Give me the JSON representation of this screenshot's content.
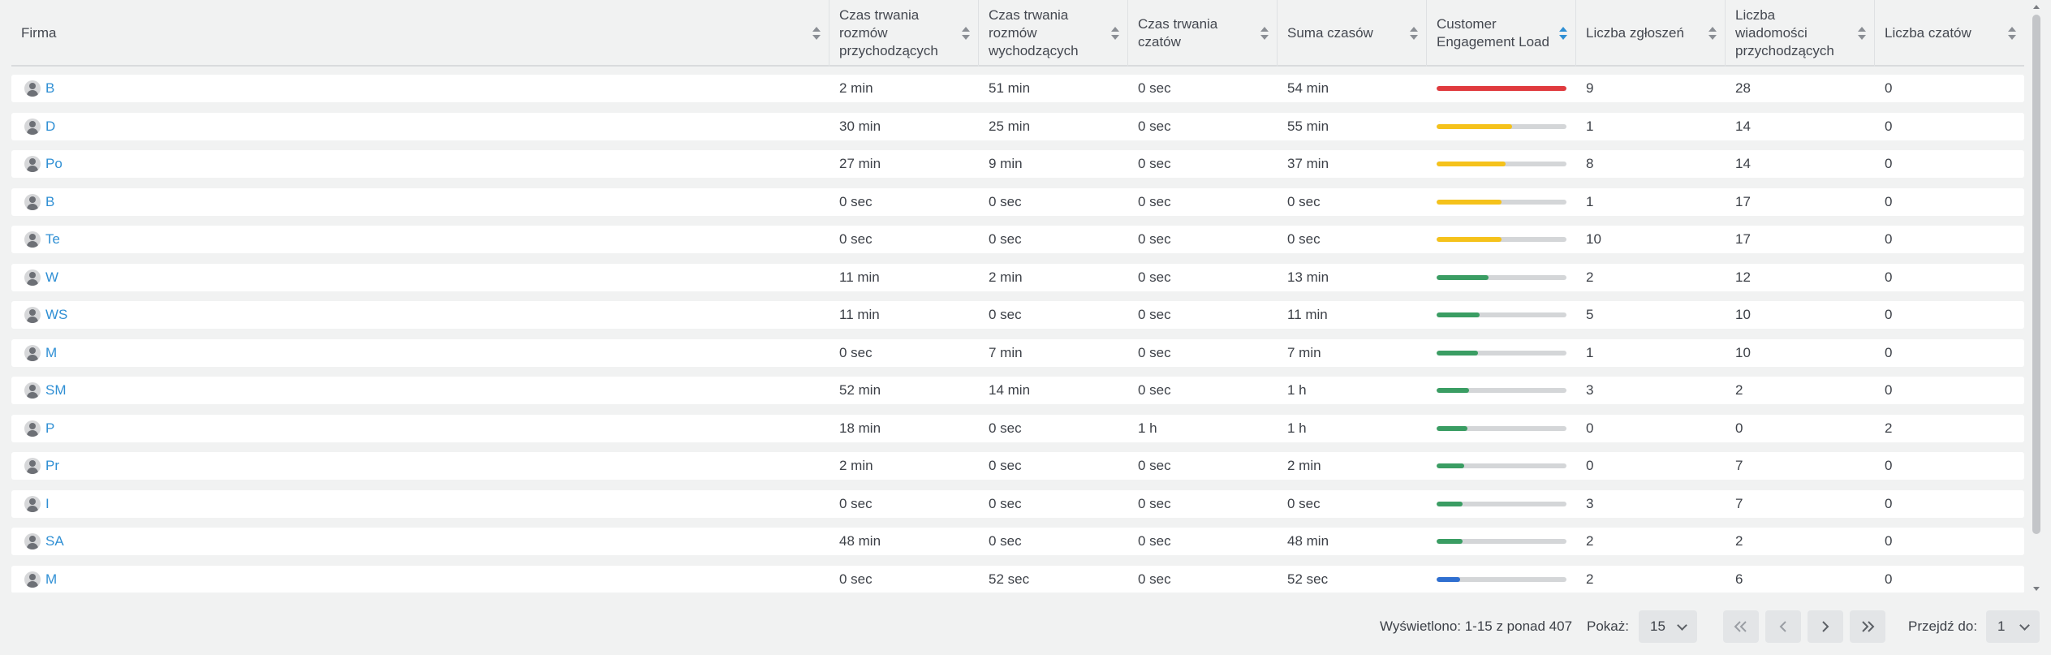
{
  "columns": [
    {
      "label": "Firma"
    },
    {
      "label": "Czas trwania rozmów przychodzących"
    },
    {
      "label": "Czas trwania rozmów wychodzących"
    },
    {
      "label": "Czas trwania czatów"
    },
    {
      "label": "Suma czasów"
    },
    {
      "label": "Customer Engagement Load"
    },
    {
      "label": "Liczba zgłoszeń"
    },
    {
      "label": "Liczba wiadomości przychodzących"
    },
    {
      "label": "Liczba czatów"
    }
  ],
  "colors": {
    "link": "#2f8fd4",
    "load_red": "#e03a3e",
    "load_yellow": "#f5c21b",
    "load_green": "#3a9d63",
    "load_blue": "#2f6fd0"
  },
  "rows": [
    {
      "firma": "B",
      "in": "2 min",
      "out": "51 min",
      "chat": "0 sec",
      "sum": "54 min",
      "load": 1.0,
      "load_color": "red",
      "tickets": "9",
      "msgs": "28",
      "chats": "0"
    },
    {
      "firma": "D",
      "in": "30 min",
      "out": "25 min",
      "chat": "0 sec",
      "sum": "55 min",
      "load": 0.58,
      "load_color": "yellow",
      "tickets": "1",
      "msgs": "14",
      "chats": "0"
    },
    {
      "firma": "Po",
      "in": "27 min",
      "out": "9 min",
      "chat": "0 sec",
      "sum": "37 min",
      "load": 0.53,
      "load_color": "yellow",
      "tickets": "8",
      "msgs": "14",
      "chats": "0"
    },
    {
      "firma": "B",
      "in": "0 sec",
      "out": "0 sec",
      "chat": "0 sec",
      "sum": "0 sec",
      "load": 0.5,
      "load_color": "yellow",
      "tickets": "1",
      "msgs": "17",
      "chats": "0"
    },
    {
      "firma": "Te",
      "in": "0 sec",
      "out": "0 sec",
      "chat": "0 sec",
      "sum": "0 sec",
      "load": 0.5,
      "load_color": "yellow",
      "tickets": "10",
      "msgs": "17",
      "chats": "0"
    },
    {
      "firma": "W",
      "in": "11 min",
      "out": "2 min",
      "chat": "0 sec",
      "sum": "13 min",
      "load": 0.4,
      "load_color": "green",
      "tickets": "2",
      "msgs": "12",
      "chats": "0"
    },
    {
      "firma": "WS",
      "in": "11 min",
      "out": "0 sec",
      "chat": "0 sec",
      "sum": "11 min",
      "load": 0.33,
      "load_color": "green",
      "tickets": "5",
      "msgs": "10",
      "chats": "0"
    },
    {
      "firma": "M",
      "in": "0 sec",
      "out": "7 min",
      "chat": "0 sec",
      "sum": "7 min",
      "load": 0.32,
      "load_color": "green",
      "tickets": "1",
      "msgs": "10",
      "chats": "0"
    },
    {
      "firma": "SM",
      "in": "52 min",
      "out": "14 min",
      "chat": "0 sec",
      "sum": "1 h",
      "load": 0.25,
      "load_color": "green",
      "tickets": "3",
      "msgs": "2",
      "chats": "0"
    },
    {
      "firma": "P",
      "in": "18 min",
      "out": "0 sec",
      "chat": "1 h",
      "sum": "1 h",
      "load": 0.24,
      "load_color": "green",
      "tickets": "0",
      "msgs": "0",
      "chats": "2"
    },
    {
      "firma": "Pr",
      "in": "2 min",
      "out": "0 sec",
      "chat": "0 sec",
      "sum": "2 min",
      "load": 0.21,
      "load_color": "green",
      "tickets": "0",
      "msgs": "7",
      "chats": "0"
    },
    {
      "firma": "I",
      "in": "0 sec",
      "out": "0 sec",
      "chat": "0 sec",
      "sum": "0 sec",
      "load": 0.2,
      "load_color": "green",
      "tickets": "3",
      "msgs": "7",
      "chats": "0"
    },
    {
      "firma": "SA",
      "in": "48 min",
      "out": "0 sec",
      "chat": "0 sec",
      "sum": "48 min",
      "load": 0.2,
      "load_color": "green",
      "tickets": "2",
      "msgs": "2",
      "chats": "0"
    },
    {
      "firma": "M",
      "in": "0 sec",
      "out": "52 sec",
      "chat": "0 sec",
      "sum": "52 sec",
      "load": 0.18,
      "load_color": "blue",
      "tickets": "2",
      "msgs": "6",
      "chats": "0"
    }
  ],
  "pagination": {
    "summary": "Wyświetlono: 1-15 z ponad 407",
    "show_label": "Pokaż:",
    "page_size": "15",
    "goto_label": "Przejdź do:",
    "goto_page": "1"
  }
}
